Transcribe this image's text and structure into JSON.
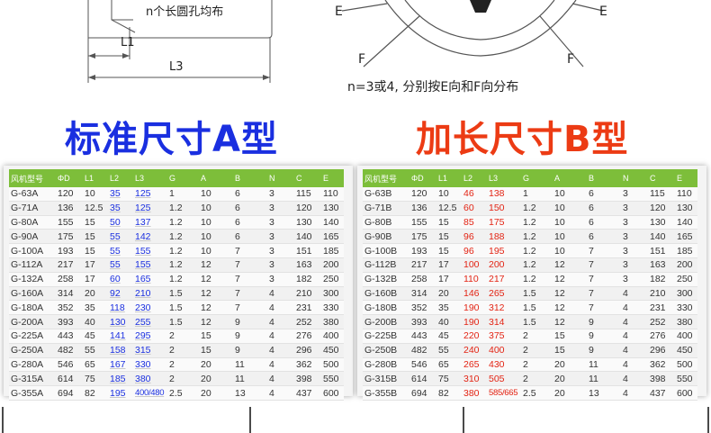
{
  "drawing_left": {
    "hole_note": "n个长圆孔均布",
    "dim_l1": "L1",
    "dim_l3": "L3"
  },
  "drawing_right": {
    "label_e_left": "E",
    "label_e_right": "E",
    "label_f_left": "F",
    "label_f_right": "F",
    "caption": "n=3或4, 分别按E向和F向分布"
  },
  "colors": {
    "heading_a": "#1a2fe0",
    "heading_b": "#ec3b14",
    "table_header": "#7dbe3a",
    "highlight_a": "#1a2fe0",
    "highlight_b": "#e32414"
  },
  "headings": {
    "a": "标准尺寸A型",
    "b": "加长尺寸B型"
  },
  "columns": [
    "风机型号",
    "ΦD",
    "L1",
    "L2",
    "L3",
    "G",
    "A",
    "B",
    "N",
    "C",
    "E"
  ],
  "table_a": [
    [
      "G-63A",
      "120",
      "10",
      "35",
      "125",
      "1",
      "10",
      "6",
      "3",
      "115",
      "110"
    ],
    [
      "G-71A",
      "136",
      "12.5",
      "35",
      "125",
      "1.2",
      "10",
      "6",
      "3",
      "120",
      "130"
    ],
    [
      "G-80A",
      "155",
      "15",
      "50",
      "137",
      "1.2",
      "10",
      "6",
      "3",
      "130",
      "140"
    ],
    [
      "G-90A",
      "175",
      "15",
      "55",
      "142",
      "1.2",
      "10",
      "6",
      "3",
      "140",
      "165"
    ],
    [
      "G-100A",
      "193",
      "15",
      "55",
      "155",
      "1.2",
      "10",
      "7",
      "3",
      "151",
      "185"
    ],
    [
      "G-112A",
      "217",
      "17",
      "55",
      "155",
      "1.2",
      "12",
      "7",
      "3",
      "163",
      "200"
    ],
    [
      "G-132A",
      "258",
      "17",
      "60",
      "165",
      "1.2",
      "12",
      "7",
      "3",
      "182",
      "250"
    ],
    [
      "G-160A",
      "314",
      "20",
      "92",
      "210",
      "1.5",
      "12",
      "7",
      "4",
      "210",
      "300"
    ],
    [
      "G-180A",
      "352",
      "35",
      "118",
      "230",
      "1.5",
      "12",
      "7",
      "4",
      "231",
      "330"
    ],
    [
      "G-200A",
      "393",
      "40",
      "130",
      "255",
      "1.5",
      "12",
      "9",
      "4",
      "252",
      "380"
    ],
    [
      "G-225A",
      "443",
      "45",
      "141",
      "295",
      "2",
      "15",
      "9",
      "4",
      "276",
      "400"
    ],
    [
      "G-250A",
      "482",
      "55",
      "158",
      "315",
      "2",
      "15",
      "9",
      "4",
      "296",
      "450"
    ],
    [
      "G-280A",
      "546",
      "65",
      "167",
      "330",
      "2",
      "20",
      "11",
      "4",
      "362",
      "500"
    ],
    [
      "G-315A",
      "614",
      "75",
      "185",
      "380",
      "2",
      "20",
      "11",
      "4",
      "398",
      "550"
    ],
    [
      "G-355A",
      "694",
      "82",
      "195",
      "400/480",
      "2.5",
      "20",
      "13",
      "4",
      "437",
      "600"
    ]
  ],
  "table_b": [
    [
      "G-63B",
      "120",
      "10",
      "46",
      "138",
      "1",
      "10",
      "6",
      "3",
      "115",
      "110"
    ],
    [
      "G-71B",
      "136",
      "12.5",
      "60",
      "150",
      "1.2",
      "10",
      "6",
      "3",
      "120",
      "130"
    ],
    [
      "G-80B",
      "155",
      "15",
      "85",
      "175",
      "1.2",
      "10",
      "6",
      "3",
      "130",
      "140"
    ],
    [
      "G-90B",
      "175",
      "15",
      "96",
      "188",
      "1.2",
      "10",
      "6",
      "3",
      "140",
      "165"
    ],
    [
      "G-100B",
      "193",
      "15",
      "96",
      "195",
      "1.2",
      "10",
      "7",
      "3",
      "151",
      "185"
    ],
    [
      "G-112B",
      "217",
      "17",
      "100",
      "200",
      "1.2",
      "12",
      "7",
      "3",
      "163",
      "200"
    ],
    [
      "G-132B",
      "258",
      "17",
      "110",
      "217",
      "1.2",
      "12",
      "7",
      "3",
      "182",
      "250"
    ],
    [
      "G-160B",
      "314",
      "20",
      "146",
      "265",
      "1.5",
      "12",
      "7",
      "4",
      "210",
      "300"
    ],
    [
      "G-180B",
      "352",
      "35",
      "190",
      "312",
      "1.5",
      "12",
      "7",
      "4",
      "231",
      "330"
    ],
    [
      "G-200B",
      "393",
      "40",
      "190",
      "314",
      "1.5",
      "12",
      "9",
      "4",
      "252",
      "380"
    ],
    [
      "G-225B",
      "443",
      "45",
      "220",
      "375",
      "2",
      "15",
      "9",
      "4",
      "276",
      "400"
    ],
    [
      "G-250B",
      "482",
      "55",
      "240",
      "400",
      "2",
      "15",
      "9",
      "4",
      "296",
      "450"
    ],
    [
      "G-280B",
      "546",
      "65",
      "265",
      "430",
      "2",
      "20",
      "11",
      "4",
      "362",
      "500"
    ],
    [
      "G-315B",
      "614",
      "75",
      "310",
      "505",
      "2",
      "20",
      "11",
      "4",
      "398",
      "550"
    ],
    [
      "G-355B",
      "694",
      "82",
      "380",
      "585/665",
      "2.5",
      "20",
      "13",
      "4",
      "437",
      "600"
    ]
  ]
}
